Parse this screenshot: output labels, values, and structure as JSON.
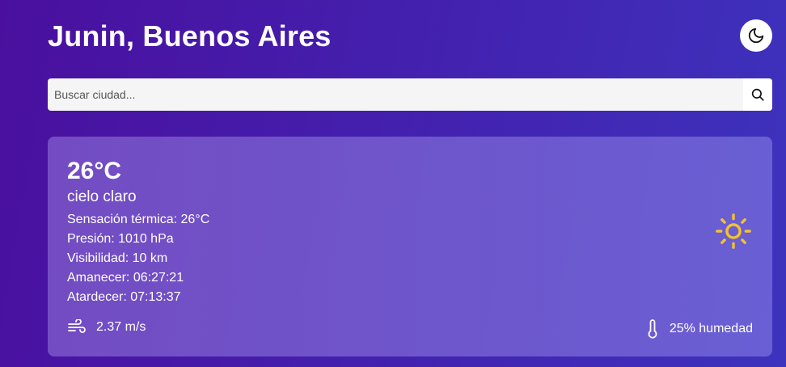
{
  "header": {
    "city_title": "Junin, Buenos Aires",
    "theme_toggle_icon": "moon-icon"
  },
  "search": {
    "placeholder": "Buscar ciudad...",
    "value": "",
    "button_icon": "search-icon"
  },
  "weather": {
    "temperature": "26°C",
    "description": "cielo claro",
    "details": [
      "Sensación térmica: 26°C",
      "Presión: 1010 hPa",
      "Visibilidad: 10 km",
      "Amanecer: 06:27:21",
      "Atardecer: 07:13:37"
    ],
    "condition_icon": "sun-icon",
    "wind_speed": "2.37 m/s",
    "humidity": "25% humedad"
  },
  "colors": {
    "background": "#4a0f9e",
    "card": "#7f62cc",
    "sun": "#f2c230",
    "text": "#ffffff"
  }
}
